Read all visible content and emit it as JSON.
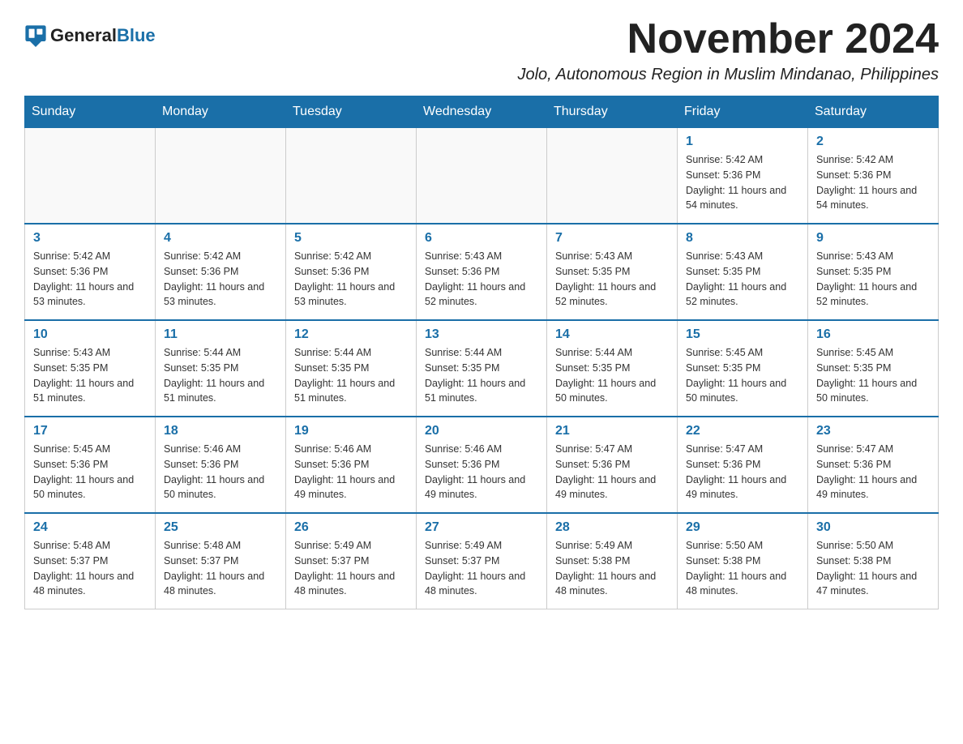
{
  "logo": {
    "text_general": "General",
    "text_blue": "Blue"
  },
  "title": "November 2024",
  "subtitle": "Jolo, Autonomous Region in Muslim Mindanao, Philippines",
  "days_of_week": [
    "Sunday",
    "Monday",
    "Tuesday",
    "Wednesday",
    "Thursday",
    "Friday",
    "Saturday"
  ],
  "weeks": [
    [
      {
        "day": "",
        "info": ""
      },
      {
        "day": "",
        "info": ""
      },
      {
        "day": "",
        "info": ""
      },
      {
        "day": "",
        "info": ""
      },
      {
        "day": "",
        "info": ""
      },
      {
        "day": "1",
        "info": "Sunrise: 5:42 AM\nSunset: 5:36 PM\nDaylight: 11 hours and 54 minutes."
      },
      {
        "day": "2",
        "info": "Sunrise: 5:42 AM\nSunset: 5:36 PM\nDaylight: 11 hours and 54 minutes."
      }
    ],
    [
      {
        "day": "3",
        "info": "Sunrise: 5:42 AM\nSunset: 5:36 PM\nDaylight: 11 hours and 53 minutes."
      },
      {
        "day": "4",
        "info": "Sunrise: 5:42 AM\nSunset: 5:36 PM\nDaylight: 11 hours and 53 minutes."
      },
      {
        "day": "5",
        "info": "Sunrise: 5:42 AM\nSunset: 5:36 PM\nDaylight: 11 hours and 53 minutes."
      },
      {
        "day": "6",
        "info": "Sunrise: 5:43 AM\nSunset: 5:36 PM\nDaylight: 11 hours and 52 minutes."
      },
      {
        "day": "7",
        "info": "Sunrise: 5:43 AM\nSunset: 5:35 PM\nDaylight: 11 hours and 52 minutes."
      },
      {
        "day": "8",
        "info": "Sunrise: 5:43 AM\nSunset: 5:35 PM\nDaylight: 11 hours and 52 minutes."
      },
      {
        "day": "9",
        "info": "Sunrise: 5:43 AM\nSunset: 5:35 PM\nDaylight: 11 hours and 52 minutes."
      }
    ],
    [
      {
        "day": "10",
        "info": "Sunrise: 5:43 AM\nSunset: 5:35 PM\nDaylight: 11 hours and 51 minutes."
      },
      {
        "day": "11",
        "info": "Sunrise: 5:44 AM\nSunset: 5:35 PM\nDaylight: 11 hours and 51 minutes."
      },
      {
        "day": "12",
        "info": "Sunrise: 5:44 AM\nSunset: 5:35 PM\nDaylight: 11 hours and 51 minutes."
      },
      {
        "day": "13",
        "info": "Sunrise: 5:44 AM\nSunset: 5:35 PM\nDaylight: 11 hours and 51 minutes."
      },
      {
        "day": "14",
        "info": "Sunrise: 5:44 AM\nSunset: 5:35 PM\nDaylight: 11 hours and 50 minutes."
      },
      {
        "day": "15",
        "info": "Sunrise: 5:45 AM\nSunset: 5:35 PM\nDaylight: 11 hours and 50 minutes."
      },
      {
        "day": "16",
        "info": "Sunrise: 5:45 AM\nSunset: 5:35 PM\nDaylight: 11 hours and 50 minutes."
      }
    ],
    [
      {
        "day": "17",
        "info": "Sunrise: 5:45 AM\nSunset: 5:36 PM\nDaylight: 11 hours and 50 minutes."
      },
      {
        "day": "18",
        "info": "Sunrise: 5:46 AM\nSunset: 5:36 PM\nDaylight: 11 hours and 50 minutes."
      },
      {
        "day": "19",
        "info": "Sunrise: 5:46 AM\nSunset: 5:36 PM\nDaylight: 11 hours and 49 minutes."
      },
      {
        "day": "20",
        "info": "Sunrise: 5:46 AM\nSunset: 5:36 PM\nDaylight: 11 hours and 49 minutes."
      },
      {
        "day": "21",
        "info": "Sunrise: 5:47 AM\nSunset: 5:36 PM\nDaylight: 11 hours and 49 minutes."
      },
      {
        "day": "22",
        "info": "Sunrise: 5:47 AM\nSunset: 5:36 PM\nDaylight: 11 hours and 49 minutes."
      },
      {
        "day": "23",
        "info": "Sunrise: 5:47 AM\nSunset: 5:36 PM\nDaylight: 11 hours and 49 minutes."
      }
    ],
    [
      {
        "day": "24",
        "info": "Sunrise: 5:48 AM\nSunset: 5:37 PM\nDaylight: 11 hours and 48 minutes."
      },
      {
        "day": "25",
        "info": "Sunrise: 5:48 AM\nSunset: 5:37 PM\nDaylight: 11 hours and 48 minutes."
      },
      {
        "day": "26",
        "info": "Sunrise: 5:49 AM\nSunset: 5:37 PM\nDaylight: 11 hours and 48 minutes."
      },
      {
        "day": "27",
        "info": "Sunrise: 5:49 AM\nSunset: 5:37 PM\nDaylight: 11 hours and 48 minutes."
      },
      {
        "day": "28",
        "info": "Sunrise: 5:49 AM\nSunset: 5:38 PM\nDaylight: 11 hours and 48 minutes."
      },
      {
        "day": "29",
        "info": "Sunrise: 5:50 AM\nSunset: 5:38 PM\nDaylight: 11 hours and 48 minutes."
      },
      {
        "day": "30",
        "info": "Sunrise: 5:50 AM\nSunset: 5:38 PM\nDaylight: 11 hours and 47 minutes."
      }
    ]
  ]
}
